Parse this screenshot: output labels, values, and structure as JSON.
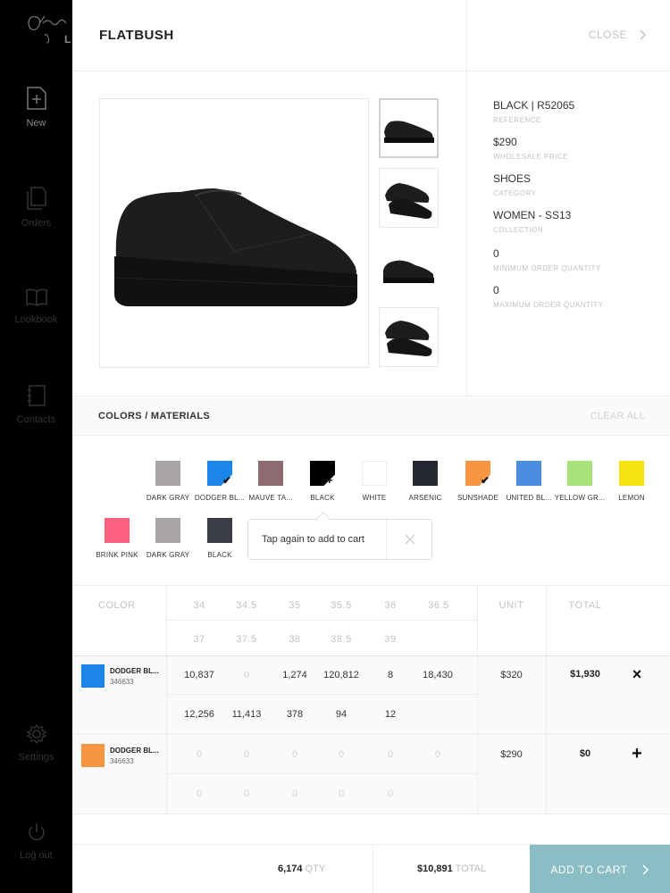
{
  "sidebar": {
    "items": [
      {
        "label": "New",
        "icon": "new-order-icon"
      },
      {
        "label": "Orders",
        "icon": "orders-icon"
      },
      {
        "label": "Lookbook",
        "icon": "lookbook-icon"
      },
      {
        "label": "Contacts",
        "icon": "contacts-icon"
      },
      {
        "label": "Settings",
        "icon": "settings-icon"
      },
      {
        "label": "Log out",
        "icon": "power-icon"
      }
    ]
  },
  "header": {
    "title": "FLATBUSH",
    "close_label": "CLOSE"
  },
  "product": {
    "fields": [
      {
        "value": "BLACK | R52065",
        "label": "REFERENCE"
      },
      {
        "value": "$290",
        "label": "WHOLESALE PRICE"
      },
      {
        "value": "SHOES",
        "label": "CATEGORY"
      },
      {
        "value": "WOMEN - SS13",
        "label": "COLLECTION"
      },
      {
        "value": "0",
        "label": "MINIMUM ORDER QUANTITY"
      },
      {
        "value": "0",
        "label": "MAXIMUM ORDER QUANTITY"
      }
    ]
  },
  "colors": {
    "title": "COLORS / MATERIALS",
    "clear_label": "CLEAR ALL",
    "swatches": [
      {
        "name": "DARK GRAY",
        "color": "#aaa6a6"
      },
      {
        "name": "DODGER BL...",
        "color": "#1b86e8",
        "mark": "✔"
      },
      {
        "name": "MAUVE TA...",
        "color": "#8d6b70"
      },
      {
        "name": "BLACK",
        "color": "#000000",
        "mark": "+"
      },
      {
        "name": "WHITE",
        "color": "#ffffff"
      },
      {
        "name": "ARSENIC",
        "color": "#25292f"
      },
      {
        "name": "SUNSHADE",
        "color": "#f79542",
        "mark": "✔"
      },
      {
        "name": "UNITED BL...",
        "color": "#4b8ee0"
      },
      {
        "name": "YELLOW GR...",
        "color": "#a8e27a"
      },
      {
        "name": "LEMON",
        "color": "#f5e213"
      },
      {
        "name": "BRINK PINK",
        "color": "#fb607f"
      },
      {
        "name": "DARK GRAY",
        "color": "#aaa6a6"
      },
      {
        "name": "BLACK",
        "color": "#3a3d44"
      }
    ],
    "tooltip": "Tap again to add to cart"
  },
  "table": {
    "headers": {
      "color": "COLOR",
      "unit": "UNIT",
      "total": "TOTAL"
    },
    "sizes_row1": [
      "34",
      "34.5",
      "35",
      "35.5",
      "36",
      "36.5"
    ],
    "sizes_row2": [
      "37",
      "37.5",
      "38",
      "38.5",
      "39"
    ],
    "rows": [
      {
        "name": "DODGER BL...",
        "ref": "346633",
        "color": "#1b86e8",
        "qty_row1": [
          "10,837",
          "0",
          "1,274",
          "120,812",
          "8",
          "18,430"
        ],
        "qty_row2": [
          "12,256",
          "11,413",
          "378",
          "94",
          "12"
        ],
        "unit": "$320",
        "total": "$1,930",
        "action": "×"
      },
      {
        "name": "DODGER BL...",
        "ref": "346633",
        "color": "#f79542",
        "qty_row1": [
          "0",
          "0",
          "0",
          "0",
          "0",
          "0"
        ],
        "qty_row2": [
          "0",
          "0",
          "0",
          "0",
          "0"
        ],
        "unit": "$290",
        "total": "$0",
        "action": "+"
      }
    ]
  },
  "footer": {
    "qty_value": "6,174",
    "qty_label": "QTY",
    "total_value": "$10,891",
    "total_label": "TOTAL",
    "add_to_cart": "ADD TO CART"
  }
}
